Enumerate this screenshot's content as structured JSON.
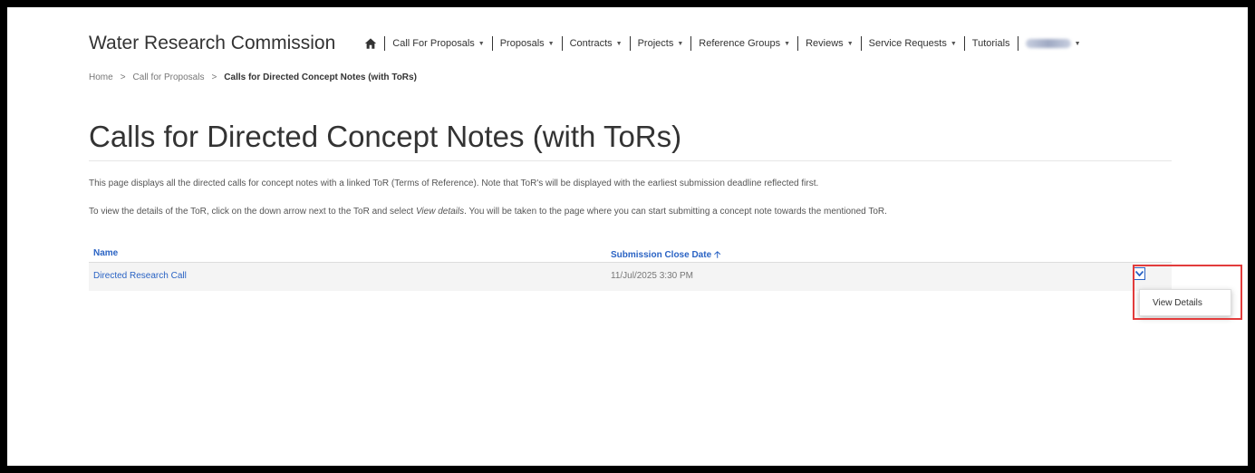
{
  "header": {
    "brand": "Water Research Commission",
    "nav": [
      {
        "label": "Call For Proposals",
        "dropdown": true
      },
      {
        "label": "Proposals",
        "dropdown": true
      },
      {
        "label": "Contracts",
        "dropdown": true
      },
      {
        "label": "Projects",
        "dropdown": true
      },
      {
        "label": "Reference Groups",
        "dropdown": true
      },
      {
        "label": "Reviews",
        "dropdown": true
      },
      {
        "label": "Service Requests",
        "dropdown": true
      },
      {
        "label": "Tutorials",
        "dropdown": false
      }
    ]
  },
  "breadcrumb": {
    "home": "Home",
    "sep": ">",
    "level1": "Call for Proposals",
    "current": "Calls for Directed Concept Notes (with ToRs)"
  },
  "page": {
    "title": "Calls for Directed Concept Notes (with ToRs)",
    "desc1": "This page displays all the directed calls for concept notes with a linked ToR (Terms of Reference). Note that ToR's will be displayed with the earliest submission deadline reflected first.",
    "desc2_before": "To view the details of the ToR, click on the down arrow next to the ToR and select ",
    "desc2_em": "View details",
    "desc2_after": ". You will be taken to the page where you can start submitting a concept note towards the mentioned ToR."
  },
  "table": {
    "columns": {
      "name": "Name",
      "date": "Submission Close Date"
    },
    "rows": [
      {
        "name": "Directed Research Call",
        "date": "11/Jul/2025 3:30 PM"
      }
    ],
    "menu_item": "View Details"
  },
  "colors": {
    "link": "#2a63c4",
    "highlight": "#e23c3c"
  }
}
